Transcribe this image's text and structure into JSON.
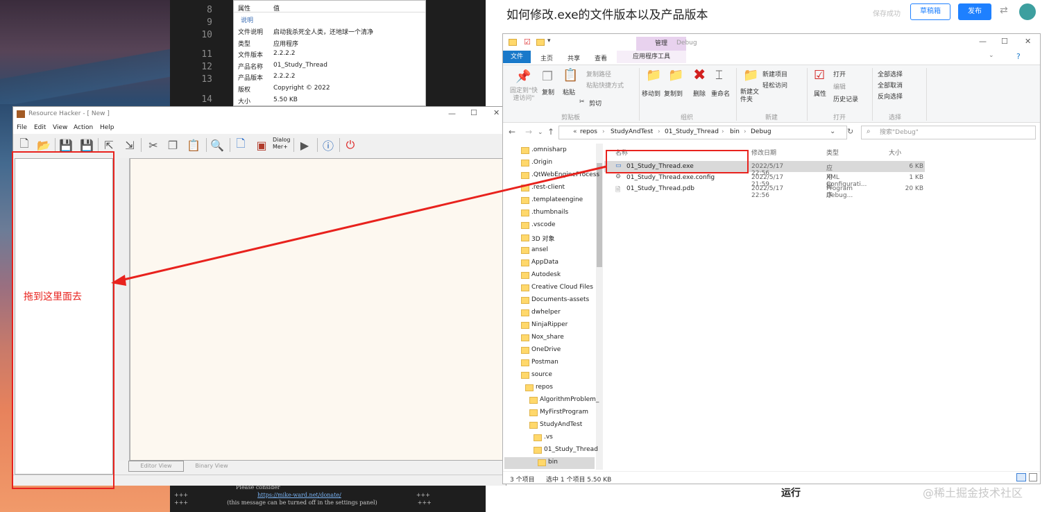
{
  "blog": {
    "title": "如何修改.exe的文件版本以及产品版本",
    "save_state": "保存成功",
    "draft_button": "草稿箱",
    "publish_button": "发布",
    "run_label": "运行",
    "watermark": "@稀土掘金技术社区"
  },
  "code_editor": {
    "line_numbers": [
      "8",
      "9",
      "10",
      "11",
      "12",
      "13",
      "14"
    ],
    "console_lines": [
      "Please consider",
      "https://mike-ward.net/donate/",
      "(this message can be turned off in the settings panel)"
    ],
    "console_plus": "+++"
  },
  "properties_dialog": {
    "col_property": "属性",
    "col_value": "值",
    "section": "说明",
    "rows": [
      {
        "k": "文件说明",
        "v": "启动我杀死全人类，还地球一个清净"
      },
      {
        "k": "类型",
        "v": "应用程序"
      },
      {
        "k": "文件版本",
        "v": "2.2.2.2"
      },
      {
        "k": "产品名称",
        "v": "01_Study_Thread"
      },
      {
        "k": "产品版本",
        "v": "2.2.2.2"
      },
      {
        "k": "版权",
        "v": "Copyright ©  2022"
      },
      {
        "k": "大小",
        "v": "5.50 KB"
      }
    ]
  },
  "resource_hacker": {
    "title": "Resource Hacker - [ New ]",
    "menu": [
      "File",
      "Edit",
      "View",
      "Action",
      "Help"
    ],
    "dialog_merge_label": "Dialog Mer+",
    "tab_editor": "Editor View",
    "tab_binary": "Binary View",
    "drag_note": "拖到这里面去"
  },
  "explorer": {
    "window_title": "Debug",
    "manage_tab": "管理",
    "tabs": {
      "file": "文件",
      "home": "主页",
      "share": "共享",
      "view": "查看",
      "tools": "应用程序工具"
    },
    "ribbon": {
      "pin": "固定到\"快速访问\"",
      "copy": "复制",
      "paste": "粘贴",
      "copy_path": "复制路径",
      "paste_shortcut": "粘贴快捷方式",
      "cut": "剪切",
      "clipboard_group": "剪贴板",
      "move_to": "移动到",
      "copy_to": "复制到",
      "delete": "删除",
      "rename": "重命名",
      "organize_group": "组织",
      "new_folder": "新建文件夹",
      "new_item": "新建项目",
      "easy_access": "轻松访问",
      "new_group": "新建",
      "properties": "属性",
      "open": "打开",
      "edit": "编辑",
      "history": "历史记录",
      "open_group": "打开",
      "select_all": "全部选择",
      "select_none": "全部取消",
      "invert_selection": "反向选择",
      "select_group": "选择"
    },
    "breadcrumb": [
      "repos",
      "StudyAndTest",
      "01_Study_Thread",
      "bin",
      "Debug"
    ],
    "breadcrumb_prefix": "«",
    "search_placeholder": "搜索\"Debug\"",
    "nav_items": [
      {
        "label": ".omnisharp",
        "indent": 0
      },
      {
        "label": ".Origin",
        "indent": 0
      },
      {
        "label": ".QtWebEngineProcess",
        "indent": 0
      },
      {
        "label": ".rest-client",
        "indent": 0
      },
      {
        "label": ".templateengine",
        "indent": 0
      },
      {
        "label": ".thumbnails",
        "indent": 0
      },
      {
        "label": ".vscode",
        "indent": 0
      },
      {
        "label": "3D 对象",
        "indent": 0
      },
      {
        "label": "ansel",
        "indent": 0
      },
      {
        "label": "AppData",
        "indent": 0
      },
      {
        "label": "Autodesk",
        "indent": 0
      },
      {
        "label": "Creative Cloud Files",
        "indent": 0
      },
      {
        "label": "Documents-assets",
        "indent": 0
      },
      {
        "label": "dwhelper",
        "indent": 0
      },
      {
        "label": "NinjaRipper",
        "indent": 0
      },
      {
        "label": "Nox_share",
        "indent": 0
      },
      {
        "label": "OneDrive",
        "indent": 0
      },
      {
        "label": "Postman",
        "indent": 0
      },
      {
        "label": "source",
        "indent": 0
      },
      {
        "label": "repos",
        "indent": 1
      },
      {
        "label": "AlgorithmProblem_",
        "indent": 2
      },
      {
        "label": "MyFirstProgram",
        "indent": 2
      },
      {
        "label": "StudyAndTest",
        "indent": 2
      },
      {
        "label": ".vs",
        "indent": 3
      },
      {
        "label": "01_Study_Thread",
        "indent": 3
      },
      {
        "label": "bin",
        "indent": 4
      }
    ],
    "columns": [
      "名称",
      "修改日期",
      "类型",
      "大小"
    ],
    "files": [
      {
        "name": "01_Study_Thread.exe",
        "date": "2022/5/17 22:56",
        "type": "应用程序",
        "size": "6 KB"
      },
      {
        "name": "01_Study_Thread.exe.config",
        "date": "2022/5/17 21:59",
        "type": "XML Configurati...",
        "size": "1 KB"
      },
      {
        "name": "01_Study_Thread.pdb",
        "date": "2022/5/17 22:56",
        "type": "Program Debug...",
        "size": "20 KB"
      }
    ],
    "status_count": "3 个项目",
    "status_selected": "选中 1 个项目  5.50 KB"
  },
  "colors": {
    "annotation_red": "#e8221d",
    "accent_blue": "#1e80ff",
    "file_tab_blue": "#1979ca"
  }
}
